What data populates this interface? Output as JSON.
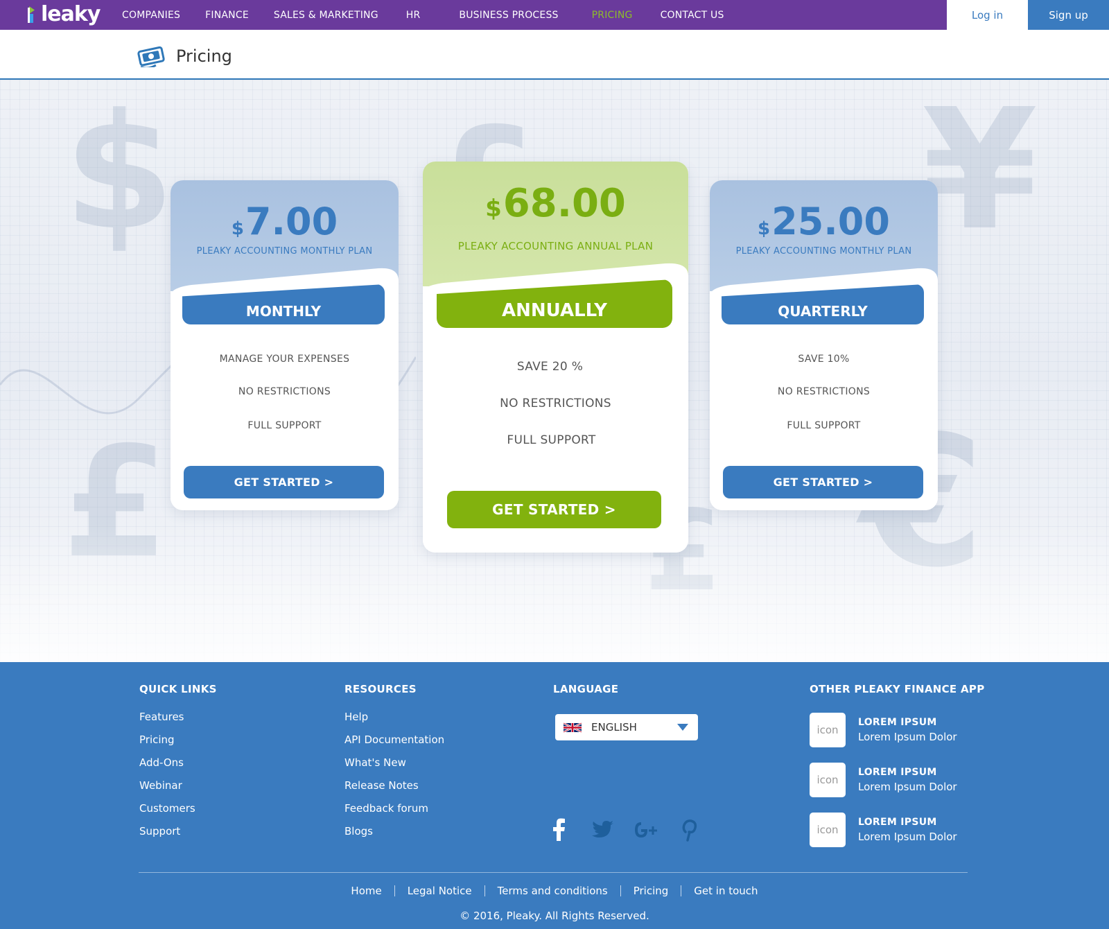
{
  "brand": {
    "logo_text": "leaky",
    "accent_purple": "#6a3a9c",
    "accent_blue": "#3a7bbf",
    "accent_green": "#82b20e"
  },
  "nav": {
    "items": [
      "COMPANIES",
      "FINANCE",
      "SALES & MARKETING",
      "HR",
      "BUSINESS PROCESS",
      "PRICING",
      "CONTACT US"
    ],
    "active": "PRICING",
    "login": "Log in",
    "signup": "Sign up"
  },
  "page": {
    "title": "Pricing",
    "icon": "money-bill-icon"
  },
  "plans": [
    {
      "currency": "$",
      "price": "7.00",
      "plan_name": "PLEAKY ACCOUNTING MONTHLY PLAN",
      "label": "MONTHLY",
      "features": [
        "MANAGE YOUR EXPENSES",
        "NO RESTRICTIONS",
        "FULL SUPPORT"
      ],
      "cta": "GET STARTED  >"
    },
    {
      "currency": "$",
      "price": "68.00",
      "plan_name": "PLEAKY ACCOUNTING ANNUAL PLAN",
      "label": "ANNUALLY",
      "features": [
        "SAVE 20 %",
        "NO RESTRICTIONS",
        "FULL SUPPORT"
      ],
      "cta": "GET STARTED  >"
    },
    {
      "currency": "$",
      "price": "25.00",
      "plan_name": "PLEAKY ACCOUNTING MONTHLY PLAN",
      "label": "QUARTERLY",
      "features": [
        "SAVE 10%",
        "NO RESTRICTIONS",
        "FULL SUPPORT"
      ],
      "cta": "GET STARTED  >"
    }
  ],
  "footer": {
    "quick_links": {
      "title": "QUICK LINKS",
      "items": [
        "Features",
        "Pricing",
        "Add-Ons",
        "Webinar",
        "Customers",
        "Support"
      ]
    },
    "resources": {
      "title": "RESOURCES",
      "items": [
        "Help",
        "API Documentation",
        "What's New",
        "Release Notes",
        "Feedback forum",
        "Blogs"
      ]
    },
    "language": {
      "title": "LANGUAGE",
      "selected": "ENGLISH",
      "flag": "uk-flag-icon"
    },
    "social": [
      "facebook-icon",
      "twitter-icon",
      "google-plus-icon",
      "pinterest-icon"
    ],
    "apps": {
      "title": "OTHER PLEAKY FINANCE APP",
      "items": [
        {
          "icon_text": "icon",
          "title": "LOREM IPSUM",
          "subtitle": "Lorem Ipsum Dolor"
        },
        {
          "icon_text": "icon",
          "title": "LOREM IPSUM",
          "subtitle": "Lorem Ipsum Dolor"
        },
        {
          "icon_text": "icon",
          "title": "LOREM IPSUM",
          "subtitle": "Lorem Ipsum Dolor"
        }
      ]
    },
    "bottom_links": [
      "Home",
      "Legal Notice",
      "Terms and conditions",
      "Pricing",
      "Get in touch"
    ],
    "copyright": "© 2016, Pleaky.  All Rights Reserved."
  }
}
